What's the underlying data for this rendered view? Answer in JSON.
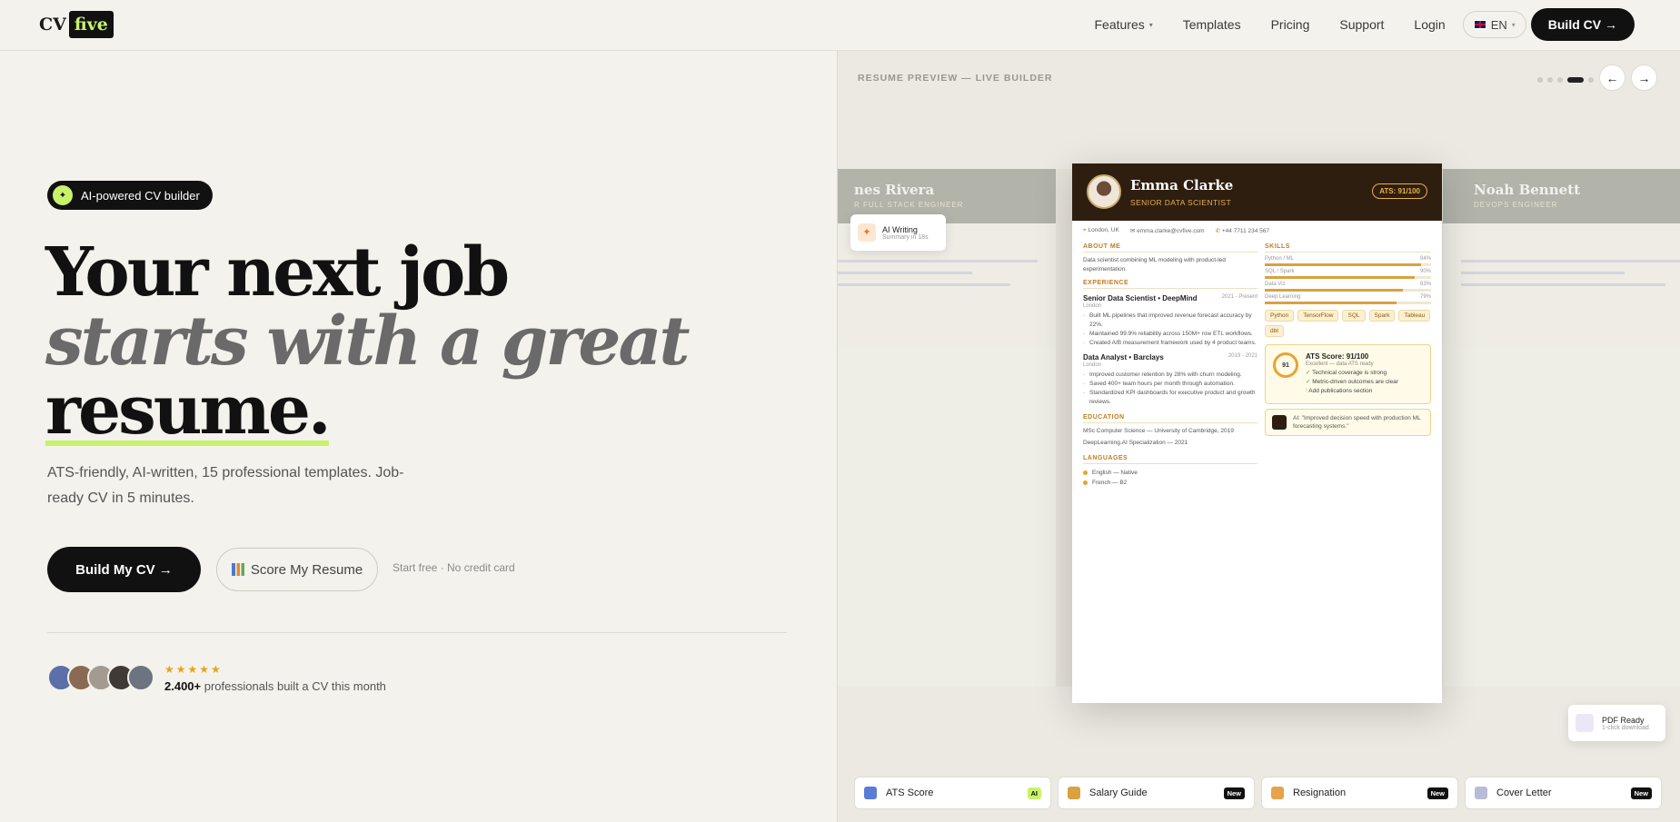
{
  "nav": {
    "logo_cv": "CV",
    "logo_five": "five",
    "links": [
      "Features",
      "Templates",
      "Pricing",
      "Support",
      "Login"
    ],
    "lang": "EN",
    "cta": "Build CV →"
  },
  "hero": {
    "badge": "AI-powered CV builder",
    "title_line1": "Your next job",
    "title_line2": "starts with a great",
    "title_line3": "resume.",
    "subtitle": "ATS-friendly, AI-written, 15 professional templates. Job-ready CV in 5 minutes.",
    "primary_btn": "Build My CV  →",
    "secondary_btn": "Score My Resume",
    "note": "Start free · No credit card",
    "stars": "★★★★★",
    "proof_count": "2.400+",
    "proof_text": "professionals built a CV this month"
  },
  "colors": {
    "accent": "#c8f26a",
    "dark": "#111111",
    "gold": "#e7b04a",
    "resume_header": "#2e1e10"
  },
  "preview": {
    "title": "RESUME PREVIEW — LIVE BUILDER",
    "prev_icon": "arrow-left-icon",
    "next_icon": "arrow-right-icon",
    "left_card": {
      "name": "nes Rivera",
      "role": "R FULL STACK ENGINEER"
    },
    "right_card": {
      "name": "Noah Bennett",
      "role": "DEVOPS ENGINEER"
    },
    "resume": {
      "name": "Emma Clarke",
      "role": "SENIOR DATA SCIENTIST",
      "ats": "ATS: 91/100",
      "location": "London, UK",
      "email": "emma.clarke@cvfive.com",
      "phone": "+44 7711 234 567",
      "about_title": "ABOUT ME",
      "about": "Data scientist combining ML modeling with product-led experimentation.",
      "exp_title": "EXPERIENCE",
      "jobs": [
        {
          "title": "Senior Data Scientist • DeepMind",
          "dates": "2021 - Present",
          "loc": "London",
          "bullets": [
            "Built ML pipelines that improved revenue forecast accuracy by 22%.",
            "Maintained 99.9% reliability across 150M+ row ETL workflows.",
            "Created A/B measurement framework used by 4 product teams."
          ]
        },
        {
          "title": "Data Analyst • Barclays",
          "dates": "2019 - 2021",
          "loc": "London",
          "bullets": [
            "Improved customer retention by 28% with churn modeling.",
            "Saved 400+ team hours per month through automation.",
            "Standardized KPI dashboards for executive product and growth reviews."
          ]
        }
      ],
      "edu_title": "EDUCATION",
      "education": [
        "MSc Computer Science — University of Cambridge, 2019",
        "DeepLearning.AI Specialization — 2021"
      ],
      "lang_title": "LANGUAGES",
      "languages": [
        "English — Native",
        "French — B2"
      ],
      "skills_title": "SKILLS",
      "skills": [
        {
          "name": "Python / ML",
          "pct": "94%",
          "level": 0.94
        },
        {
          "name": "SQL / Spark",
          "pct": "90%",
          "level": 0.9
        },
        {
          "name": "Data Viz",
          "pct": "83%",
          "level": 0.83
        },
        {
          "name": "Deep Learning",
          "pct": "79%",
          "level": 0.79
        }
      ],
      "tags": [
        "Python",
        "TensorFlow",
        "SQL",
        "Spark",
        "Tableau",
        "dbt"
      ],
      "ats_box": {
        "score": "91",
        "title": "ATS Score: 91/100",
        "sub": "Excellent — data ATS ready",
        "checks": [
          {
            "mark": "✓",
            "text": "Technical coverage is strong",
            "ok": true
          },
          {
            "mark": "✓",
            "text": "Metric-driven outcomes are clear",
            "ok": true
          },
          {
            "mark": "!",
            "text": "Add publications section",
            "ok": false
          }
        ]
      },
      "ai_note": "AI: \"Improved decision speed with production ML forecasting systems.\""
    },
    "float_ai": {
      "title": "AI Writing",
      "sub": "Summary in 18s"
    },
    "float_pdf": {
      "title": "PDF Ready",
      "sub": "1-click download"
    },
    "tools": [
      {
        "label": "ATS Score",
        "badge": "AI",
        "icon": "chart-icon",
        "color": "#5a7bd6"
      },
      {
        "label": "Salary Guide",
        "badge": "New",
        "icon": "money-bag-icon",
        "color": "#d9a23e"
      },
      {
        "label": "Resignation",
        "badge": "New",
        "icon": "writing-hand-icon",
        "color": "#e8a24a"
      },
      {
        "label": "Cover Letter",
        "badge": "New",
        "icon": "envelope-icon",
        "color": "#b8bcd6"
      }
    ]
  }
}
